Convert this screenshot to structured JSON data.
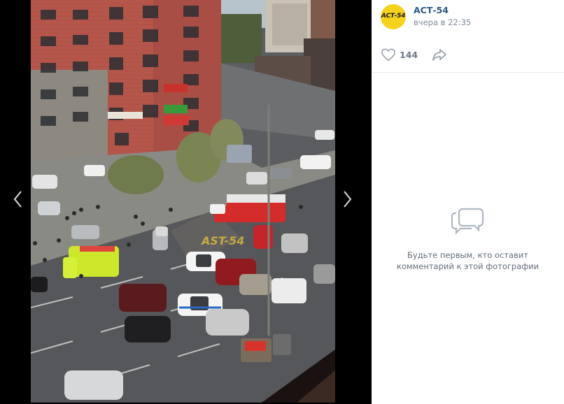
{
  "viewer": {
    "prev_icon": "chevron-left-icon",
    "next_icon": "chevron-right-icon",
    "prev_glyph": "‹",
    "next_glyph": "›",
    "watermark": "AST-54"
  },
  "post": {
    "group_name": "АСТ-54",
    "avatar_text": "АСТ-54",
    "date": "вчера в 22:35",
    "likes": "144",
    "like_icon": "heart-icon",
    "share_icon": "share-arrow-icon"
  },
  "comments": {
    "empty_icon": "comments-bubble-icon",
    "empty_line1": "Будьте первым, кто оставит",
    "empty_line2": "комментарий к этой фотографии"
  },
  "colors": {
    "accent_link": "#2a5885",
    "muted": "#818c99",
    "avatar_bg": "#f6d21c"
  }
}
